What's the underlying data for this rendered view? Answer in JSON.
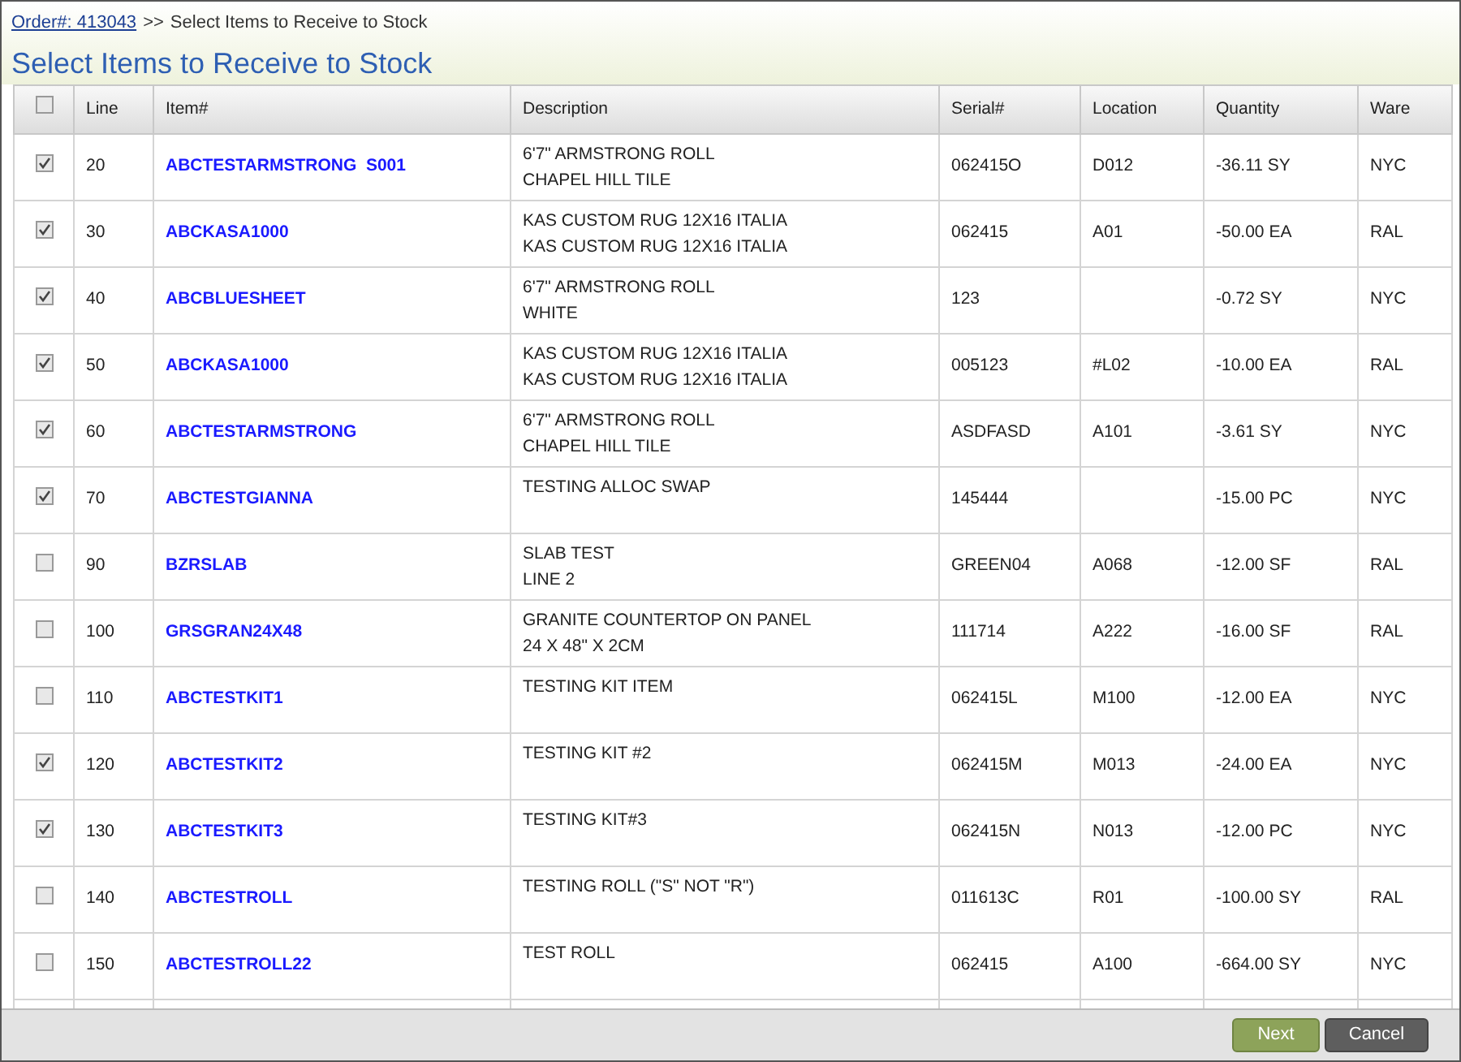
{
  "breadcrumb": {
    "link": "Order#: 413043",
    "separator": ">>",
    "current": "Select Items to Receive to Stock"
  },
  "title": "Select Items to Receive to Stock",
  "table": {
    "select_all": {
      "checked": false
    },
    "columns": [
      "Line",
      "Item#",
      "Description",
      "Serial#",
      "Location",
      "Quantity",
      "Ware"
    ],
    "rows": [
      {
        "checked": true,
        "line": "20",
        "item": "ABCTESTARMSTRONG  S001",
        "description": [
          "6'7\" ARMSTRONG ROLL",
          "CHAPEL HILL TILE"
        ],
        "serial": "062415O",
        "location": "D012",
        "quantity": "-36.11 SY",
        "ware": "NYC"
      },
      {
        "checked": true,
        "line": "30",
        "item": "ABCKASA1000",
        "description": [
          "KAS CUSTOM RUG 12X16 ITALIA",
          "KAS CUSTOM RUG 12X16 ITALIA"
        ],
        "serial": "062415",
        "location": "A01",
        "quantity": "-50.00 EA",
        "ware": "RAL"
      },
      {
        "checked": true,
        "line": "40",
        "item": "ABCBLUESHEET",
        "description": [
          "6'7\" ARMSTRONG ROLL",
          "WHITE"
        ],
        "serial": "123",
        "quantity": "-0.72 SY",
        "ware": "NYC"
      },
      {
        "checked": true,
        "line": "50",
        "item": "ABCKASA1000",
        "description": [
          "KAS CUSTOM RUG 12X16 ITALIA",
          "KAS CUSTOM RUG 12X16 ITALIA"
        ],
        "serial": "005123",
        "location": "#L02",
        "quantity": "-10.00 EA",
        "ware": "RAL"
      },
      {
        "checked": true,
        "line": "60",
        "item": "ABCTESTARMSTRONG",
        "description": [
          "6'7\" ARMSTRONG ROLL",
          "CHAPEL HILL TILE"
        ],
        "serial": "ASDFASD",
        "location": "A101",
        "quantity": "-3.61 SY",
        "ware": "NYC"
      },
      {
        "checked": true,
        "line": "70",
        "item": "ABCTESTGIANNA",
        "description": [
          "TESTING ALLOC SWAP"
        ],
        "serial": "145444",
        "quantity": "-15.00 PC",
        "ware": "NYC"
      },
      {
        "checked": false,
        "line": "90",
        "item": "BZRSLAB",
        "description": [
          "SLAB TEST",
          "LINE 2"
        ],
        "serial": "GREEN04",
        "location": "A068",
        "quantity": "-12.00 SF",
        "ware": "RAL"
      },
      {
        "checked": false,
        "line": "100",
        "item": "GRSGRAN24X48",
        "description": [
          "GRANITE COUNTERTOP ON PANEL",
          "24 X 48\" X 2CM"
        ],
        "serial": "111714",
        "location": "A222",
        "quantity": "-16.00 SF",
        "ware": "RAL"
      },
      {
        "checked": false,
        "line": "110",
        "item": "ABCTESTKIT1",
        "description": [
          "TESTING KIT ITEM"
        ],
        "serial": "062415L",
        "location": "M100",
        "quantity": "-12.00 EA",
        "ware": "NYC"
      },
      {
        "checked": true,
        "line": "120",
        "item": "ABCTESTKIT2",
        "description": [
          "TESTING KIT #2"
        ],
        "serial": "062415M",
        "location": "M013",
        "quantity": "-24.00 EA",
        "ware": "NYC"
      },
      {
        "checked": true,
        "line": "130",
        "item": "ABCTESTKIT3",
        "description": [
          "TESTING KIT#3"
        ],
        "serial": "062415N",
        "location": "N013",
        "quantity": "-12.00 PC",
        "ware": "NYC"
      },
      {
        "checked": false,
        "line": "140",
        "item": "ABCTESTROLL",
        "description": [
          "TESTING ROLL (\"S\" NOT \"R\")"
        ],
        "serial": "011613C",
        "location": "R01",
        "quantity": "-100.00 SY",
        "ware": "RAL"
      },
      {
        "checked": false,
        "line": "150",
        "item": "ABCTESTROLL22",
        "description": [
          "TEST ROLL"
        ],
        "serial": "062415",
        "location": "A100",
        "quantity": "-664.00 SY",
        "ware": "NYC"
      }
    ]
  },
  "buttons": {
    "next": "Next",
    "cancel": "Cancel"
  }
}
